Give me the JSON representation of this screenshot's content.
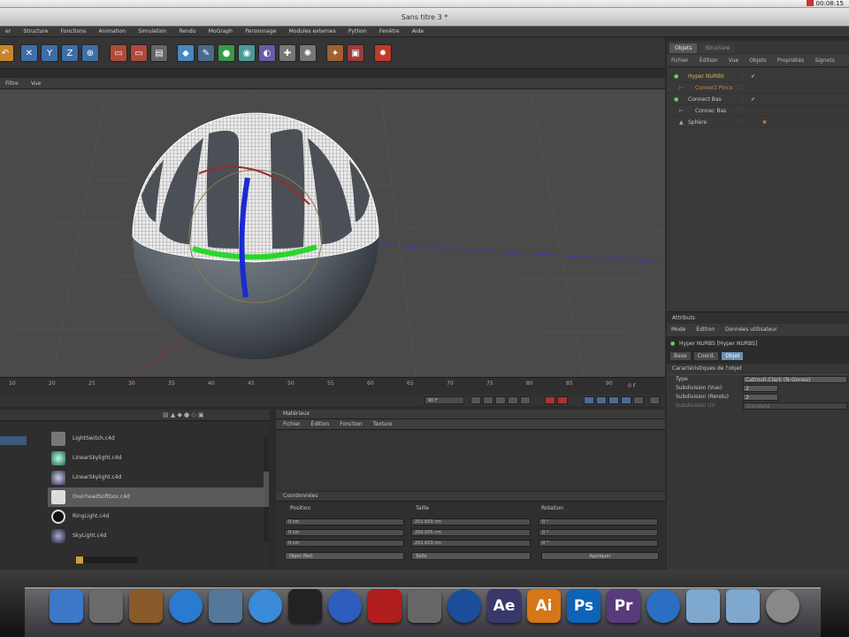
{
  "window": {
    "title": "Sans titre 3 *",
    "clock": "00:08:15"
  },
  "menubar": [
    "er",
    "Structure",
    "Fonctions",
    "Animation",
    "Simulation",
    "Rendu",
    "MoGraph",
    "Personnage",
    "Modules externes",
    "Python",
    "Fenêtre",
    "Aide"
  ],
  "viewport": {
    "menu": [
      "Filtre",
      "Vue"
    ]
  },
  "timeline": {
    "ticks": [
      "10",
      "20",
      "25",
      "30",
      "35",
      "40",
      "45",
      "50",
      "55",
      "60",
      "65",
      "70",
      "75",
      "80",
      "85",
      "90"
    ],
    "frame_end": "0 F",
    "frame_field": "90 F"
  },
  "objects_panel": {
    "tabs": [
      "Objets",
      "Structure"
    ],
    "menu": [
      "Fichier",
      "Édition",
      "Vue",
      "Objets",
      "Propriétés",
      "Signets"
    ],
    "items": [
      "Hyper NURBS",
      "Connect Pince",
      "Connect Bas",
      "Connec Bas",
      "Sphère"
    ]
  },
  "attributes_panel": {
    "title": "Attributs",
    "menu": [
      "Mode",
      "Édition",
      "Données utilisateur"
    ],
    "object_name": "Hyper NURBS [Hyper NURBS]",
    "tabs": [
      "Base",
      "Coord.",
      "Objet"
    ],
    "section": "Caractéristiques de l'objet",
    "rows": [
      {
        "label": "Type",
        "value": "Catmull-Clark (N-Gones)"
      },
      {
        "label": "Subdivision (Vue)",
        "value": "2"
      },
      {
        "label": "Subdivision (Rendu)",
        "value": "2"
      },
      {
        "label": "Subdivision UV",
        "value": "Standard"
      }
    ]
  },
  "library": {
    "items": [
      "LightSwitch.c4d",
      "LinearSkylight.c4d",
      "LinearSkylight.c4d",
      "OverheadSoftbox.c4d",
      "RingLight.c4d",
      "SkyLight.c4d"
    ],
    "selected": 3
  },
  "materials": {
    "title": "Matériaux",
    "menu": [
      "Fichier",
      "Édition",
      "Fonction",
      "Texture"
    ]
  },
  "coordinates": {
    "title": "Coordonnées",
    "headers": [
      "Position",
      "Taille",
      "Rotation"
    ],
    "rows": [
      [
        "0 cm",
        "201.603 cm",
        "0 °"
      ],
      [
        "0 cm",
        "200.005 cm",
        "0 °"
      ],
      [
        "0 cm",
        "201.603 cm",
        "0 °"
      ]
    ],
    "mode": "Objet (Rel)",
    "size_mode": "Taille",
    "apply": "Appliquer"
  },
  "dock": [
    {
      "name": "finder",
      "color": "#3d78c8"
    },
    {
      "name": "rocket",
      "color": "#6a6a6a"
    },
    {
      "name": "preview",
      "color": "#8a5a2a"
    },
    {
      "name": "app-store",
      "color": "#2a7ad0"
    },
    {
      "name": "photo",
      "color": "#557799"
    },
    {
      "name": "safari",
      "color": "#3a8ad8"
    },
    {
      "name": "cinema",
      "color": "#222"
    },
    {
      "name": "itunes",
      "color": "#2c5dbf"
    },
    {
      "name": "photo-booth",
      "color": "#b01d1d"
    },
    {
      "name": "utility",
      "color": "#666"
    },
    {
      "name": "cinema4d",
      "color": "#1a4e9a"
    },
    {
      "name": "after-effects",
      "color": "#39386b",
      "label": "Ae"
    },
    {
      "name": "illustrator",
      "color": "#d67617",
      "label": "Ai"
    },
    {
      "name": "photoshop",
      "color": "#0d63b8",
      "label": "Ps"
    },
    {
      "name": "premiere",
      "color": "#573b7b",
      "label": "Pr"
    },
    {
      "name": "quicktime",
      "color": "#2a6fc2"
    },
    {
      "name": "folder",
      "color": "#7fa8cf"
    },
    {
      "name": "folder",
      "color": "#7fa8cf"
    },
    {
      "name": "trash",
      "color": "#888"
    }
  ]
}
